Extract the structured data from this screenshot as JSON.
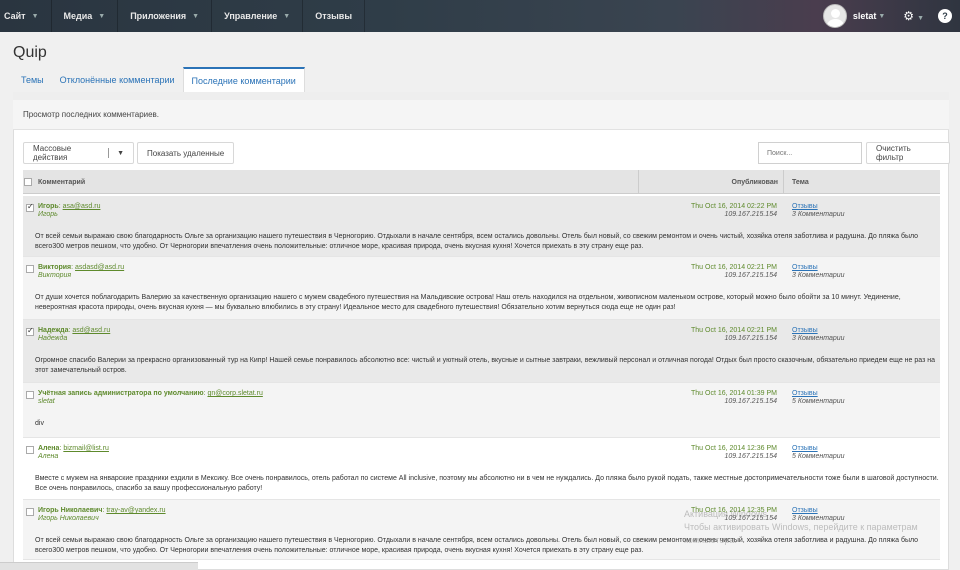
{
  "topnav": [
    {
      "label": "Сайт",
      "caret": true
    },
    {
      "label": "Медиа",
      "caret": true
    },
    {
      "label": "Приложения",
      "caret": true
    },
    {
      "label": "Управление",
      "caret": true
    },
    {
      "label": "Отзывы",
      "caret": false
    }
  ],
  "user": {
    "name": "sletat"
  },
  "page_title": "Quip",
  "tabs": [
    {
      "label": "Темы",
      "active": false
    },
    {
      "label": "Отклонённые комментарии",
      "active": false
    },
    {
      "label": "Последние комментарии",
      "active": true
    }
  ],
  "description": "Просмотр последних комментариев.",
  "toolbar": {
    "bulk_actions": "Массовые действия",
    "show_deleted": "Показать удаленные",
    "search_placeholder": "Поиск...",
    "clear_filter": "Очистить фильтр"
  },
  "columns": {
    "comment": "Комментарий",
    "published": "Опубликован",
    "topic": "Тема"
  },
  "rows": [
    {
      "checked": true,
      "name": "Игорь",
      "email": "asa@asd.ru",
      "alias": "Игорь",
      "date": "Thu Oct 16, 2014 02:22 PM",
      "ip": "109.167.215.154",
      "topic": "Отзывы",
      "count": "3 Комментарии",
      "body": "От всей семьи выражаю свою благодарность Ольге за организацию нашего путешествия в Черногорию. Отдыхали в начале сентября, всем остались довольны. Отель был новый, со свежим ремонтом и очень чистый, хозяйка отеля заботлива и радушна. До пляжа было всего300 метров пешком, что удобно. От Черногории впечатления очень положительные: отличное море, красивая природа, очень вкусная кухня! Хочется приехать в эту страну еще раз."
    },
    {
      "checked": false,
      "name": "Виктория",
      "email": "asdasd@asd.ru",
      "alias": "Виктория",
      "date": "Thu Oct 16, 2014 02:21 PM",
      "ip": "109.167.215.154",
      "topic": "Отзывы",
      "count": "3 Комментарии",
      "body": "От души хочется поблагодарить Валерию за качественную организацию нашего с мужем свадебного путешествия на Мальдивские острова! Наш отель находился на отдельном, живописном маленьком острове, который можно было обойти за 10 минут. Уединение, невероятная красота природы, очень вкусная кухня — мы буквально влюбились в эту страну! Идеальное место для свадебного путешествия! Обязательно хотим вернуться сюда еще не один раз!"
    },
    {
      "checked": true,
      "name": "Надежда",
      "email": "asd@asd.ru",
      "alias": "Надежда",
      "date": "Thu Oct 16, 2014 02:21 PM",
      "ip": "109.167.215.154",
      "topic": "Отзывы",
      "count": "3 Комментарии",
      "body": "Огромное спасибо Валерии за прекрасно организованный тур на Кипр! Нашей семье понравилось абсолютно все: чистый и уютный отель, вкусные и сытные завтраки, вежливый персонал и отличная погода! Отдых был просто сказочным, обязательно приедем еще не раз на этот замечательный остров."
    },
    {
      "checked": false,
      "name": "Учётная запись администратора по умолчанию",
      "email": "gn@corp.sletat.ru",
      "alias": "sletat",
      "date": "Thu Oct 16, 2014 01:39 PM",
      "ip": "109.167.215.154",
      "topic": "Отзывы",
      "count": "5 Комментарии",
      "body": "div"
    },
    {
      "checked": false,
      "name": "Алена",
      "email": "bizmail@list.ru",
      "alias": "Алена",
      "date": "Thu Oct 16, 2014 12:36 PM",
      "ip": "109.167.215.154",
      "topic": "Отзывы",
      "count": "5 Комментарии",
      "body": "Вместе с мужем на январские праздники ездили в Мексику. Все очень понравилось, отель работал по системе All inclusive, поэтому мы абсолютно ни в чем не нуждались. До пляжа было рукой подать, также местные достопримечательности тоже были в шаговой доступности. Все очень понравилось, спасибо за вашу профессиональную работу!"
    },
    {
      "checked": false,
      "name": "Игорь Николаевич",
      "email": "tray-av@yandex.ru",
      "alias": "Игорь Николаевич",
      "date": "Thu Oct 16, 2014 12:35 PM",
      "ip": "109.167.215.154",
      "topic": "Отзывы",
      "count": "3 Комментарии",
      "body": "От всей семьи выражаю свою благодарность Ольге за организацию нашего путешествия в Черногорию. Отдыхали в начале сентября, всем остались довольны. Отель был новый, со свежим ремонтом и очень чистый, хозяйка отеля заботлива и радушна. До пляжа было всего300 метров пешком, что удобно. От Черногории впечатления очень положительные: отличное море, красивая природа, очень вкусная кухня! Хочется приехать в эту страну еще раз."
    }
  ],
  "watermark": {
    "line1": "Активация Windows",
    "line2": "Чтобы активировать Windows, перейдите к параметрам",
    "line3": "компьютера."
  }
}
